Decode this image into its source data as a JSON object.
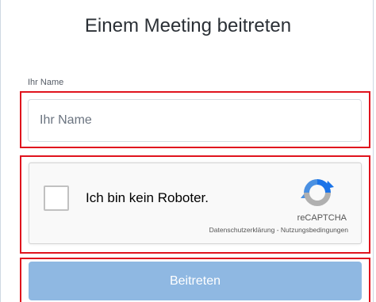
{
  "page": {
    "title": "Einem Meeting beitreten"
  },
  "name_field": {
    "label": "Ihr Name",
    "placeholder": "Ihr Name",
    "value": ""
  },
  "recaptcha": {
    "checkbox_label": "Ich bin kein Roboter.",
    "brand": "reCAPTCHA",
    "privacy_link": "Datenschutzerklärung",
    "separator": " - ",
    "terms_link": "Nutzungsbedingungen",
    "checked": false
  },
  "submit": {
    "label": "Beitreten"
  },
  "colors": {
    "highlight": "#e0141e",
    "button_bg": "#8fb8e2",
    "recaptcha_blue": "#1a73e8",
    "recaptcha_light_blue": "#4a90e2",
    "recaptcha_gray": "#b0b0b0"
  }
}
